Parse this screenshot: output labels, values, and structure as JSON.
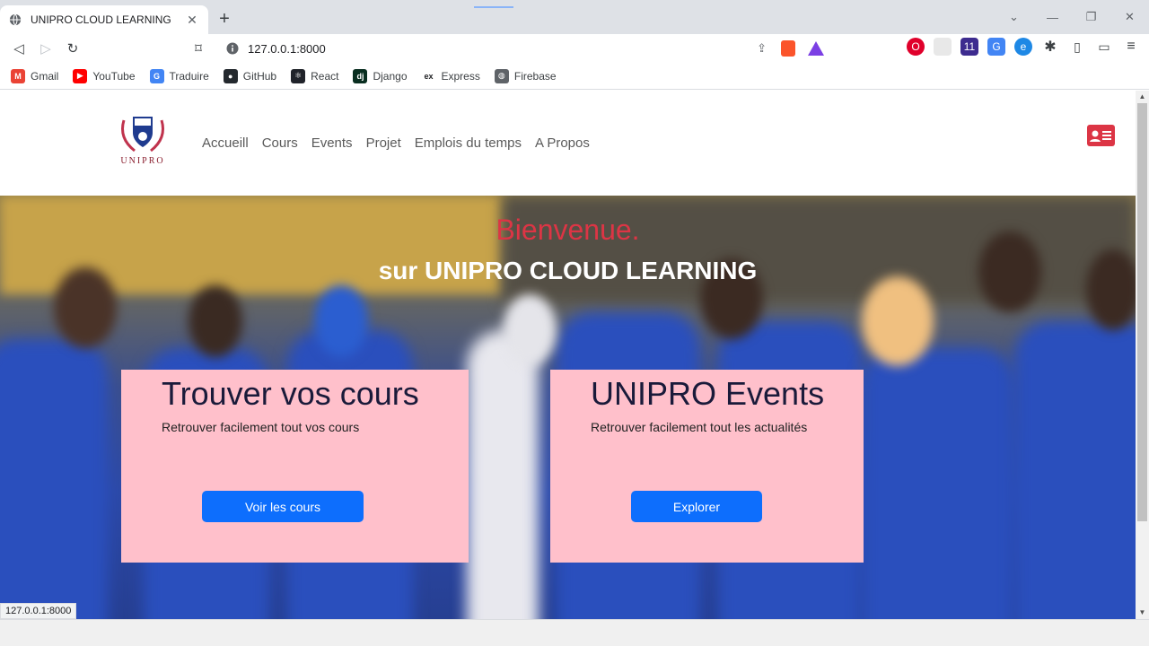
{
  "browser": {
    "tab_title": "UNIPRO CLOUD LEARNING",
    "url": "127.0.0.1:8000",
    "status_url": "127.0.0.1:8000",
    "bookmarks": [
      {
        "label": "Gmail",
        "icon": "gmail-icon",
        "color": "#ea4335",
        "glyph": "M"
      },
      {
        "label": "YouTube",
        "icon": "youtube-icon",
        "color": "#ff0000",
        "glyph": "▶"
      },
      {
        "label": "Traduire",
        "icon": "translate-icon",
        "color": "#4285f4",
        "glyph": "G"
      },
      {
        "label": "GitHub",
        "icon": "github-icon",
        "color": "#24292e",
        "glyph": "●"
      },
      {
        "label": "React",
        "icon": "react-icon",
        "color": "#20232a",
        "glyph": "⚛"
      },
      {
        "label": "Django",
        "icon": "django-icon",
        "color": "#092e20",
        "glyph": "dj"
      },
      {
        "label": "Express",
        "icon": "express-icon",
        "color": "#ffffff",
        "glyph": "ex"
      },
      {
        "label": "Firebase",
        "icon": "globe-icon",
        "color": "#5f6368",
        "glyph": "◍"
      }
    ]
  },
  "site": {
    "logo_text": "UNIPRO",
    "nav": [
      "Accueill",
      "Cours",
      "Events",
      "Projet",
      "Emplois du temps",
      "A Propos"
    ]
  },
  "hero": {
    "title": "Bienvenue.",
    "subtitle": "sur UNIPRO CLOUD LEARNING"
  },
  "cards": [
    {
      "title": "Trouver vos cours",
      "text": "Retrouver facilement tout vos cours",
      "button": "Voir les cours"
    },
    {
      "title": "UNIPRO Events",
      "text": "Retrouver facilement tout les actualités",
      "button": "Explorer"
    }
  ],
  "colors": {
    "accent_red": "#dc3545",
    "card_pink": "#ffc0cb",
    "button_blue": "#0d6efd"
  }
}
